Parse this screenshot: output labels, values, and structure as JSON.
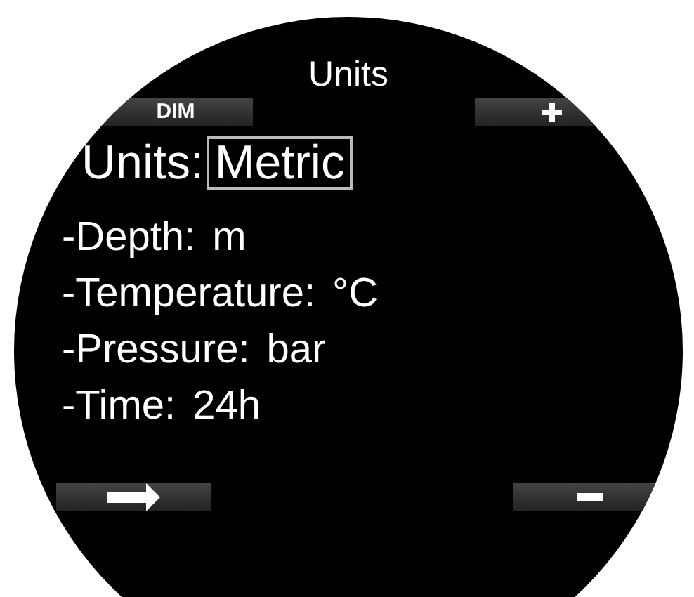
{
  "screen": {
    "title": "Units",
    "top_softkeys": [
      {
        "kind": "text",
        "label": "DIM"
      },
      {
        "kind": "plus"
      }
    ],
    "setting": {
      "label": "Units:",
      "value": "Metric",
      "selected": true
    },
    "details": [
      {
        "label": "-Depth:",
        "value": "m"
      },
      {
        "label": "-Temperature:",
        "value": "°C"
      },
      {
        "label": "-Pressure:",
        "value": "bar"
      },
      {
        "label": "-Time:",
        "value": "24h"
      }
    ],
    "bottom_softkeys": [
      {
        "kind": "arrow"
      },
      {
        "kind": "minus"
      }
    ]
  }
}
